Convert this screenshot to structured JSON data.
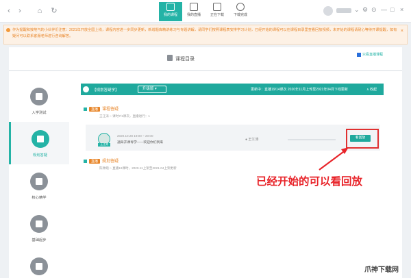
{
  "toolbar": {
    "tabs": [
      {
        "label": "我的课程",
        "icon": "course-icon"
      },
      {
        "label": "我的直播",
        "icon": "live-icon"
      },
      {
        "label": "正在下载",
        "icon": "download-icon"
      },
      {
        "label": "下载完成",
        "icon": "check-icon"
      }
    ],
    "accent": "#24b3a6"
  },
  "notice": {
    "text": "作为提醒和接地气的小伙伴们注意：2021年开放全国上线，课程内容进一步同步更新，新增题库精讲练习与专题讲解，请同学们按照课程表安排学习计划，已经开始的课程可以在课程目录里查看回放视频，未开始的课程请耐心等待开课提醒，如有疑问可以联系客服老师进行咨询解答。",
    "close": "×"
  },
  "directory": {
    "title": "课程目录",
    "checkbox_label": "只看直播课程"
  },
  "sidebar": {
    "items": [
      {
        "label": "入学测试",
        "icon": "test-icon"
      },
      {
        "label": "规划答疑",
        "icon": "book-icon"
      },
      {
        "label": "核心精学",
        "icon": "study-icon"
      },
      {
        "label": "基础起步",
        "icon": "base-icon"
      },
      {
        "label": "",
        "icon": "more-icon"
      }
    ]
  },
  "course": {
    "title": "【规划答疑学】",
    "dropdown": "升级版",
    "meta": "更新中：直播19/14课次    2020年11月上传至2021年04月下线更新",
    "collapse": "∧ 收起"
  },
  "sections": [
    {
      "badge": "直播",
      "title": "课程答疑",
      "sub": "王江涛    ○ 课时7/1课次，直播进行：1"
    },
    {
      "badge": "直播",
      "title": "规划答疑",
      "sub": "陈钟跑    ○ 直播19课时，2020-11上架至2021-04上架更新"
    }
  ],
  "lesson": {
    "time": "2020.10.28 19:00 ~ 20:00",
    "name": "通知开课导学——欢迎你们到来",
    "teacher": "王江涛",
    "teacher_tag": "王江涛",
    "progress": 0,
    "playback_label": "看回放"
  },
  "annotation": "已经开始的可以看回放",
  "watermark": "爪神下载网"
}
